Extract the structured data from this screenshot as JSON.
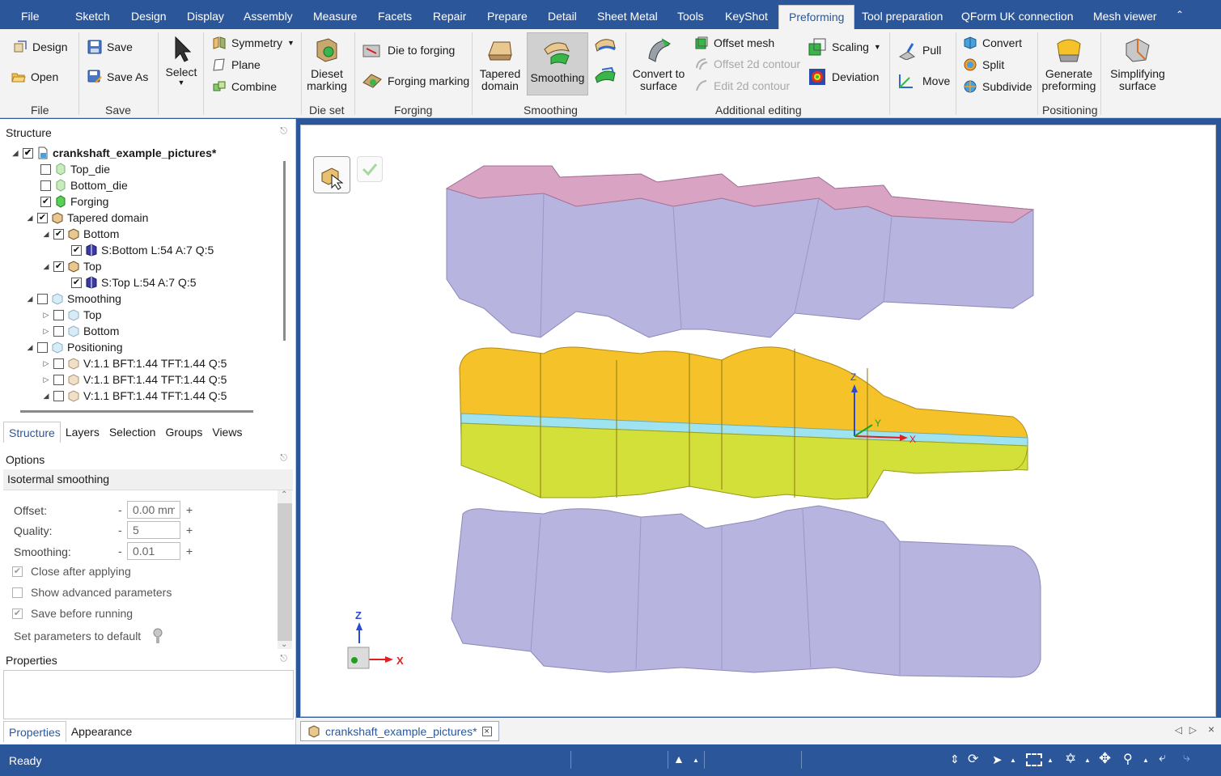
{
  "menu": {
    "items": [
      "File",
      "Sketch",
      "Design",
      "Display",
      "Assembly",
      "Measure",
      "Facets",
      "Repair",
      "Prepare",
      "Detail",
      "Sheet Metal",
      "Tools",
      "KeyShot",
      "Preforming",
      "Tool preparation",
      "QForm UK connection",
      "Mesh viewer"
    ],
    "active": "Preforming"
  },
  "ribbon": {
    "file": {
      "label": "File",
      "design": "Design",
      "open": "Open"
    },
    "save": {
      "label": "Save",
      "save": "Save",
      "save_as": "Save As"
    },
    "select": {
      "label": "Select"
    },
    "symmetry": "Symmetry",
    "plane": "Plane",
    "combine": "Combine",
    "dieset": {
      "label": "Die set",
      "btn_line1": "Dieset",
      "btn_line2": "marking"
    },
    "forging": {
      "label": "Forging",
      "die_to_forging": "Die to forging",
      "forging_marking": "Forging marking"
    },
    "smoothing": {
      "label": "Smoothing",
      "tapered_line1": "Tapered",
      "tapered_line2": "domain",
      "smoothing": "Smoothing"
    },
    "additional": {
      "label": "Additional editing",
      "convert_line1": "Convert to",
      "convert_line2": "surface",
      "offset_mesh": "Offset mesh",
      "offset_2d": "Offset 2d contour",
      "edit_2d": "Edit 2d contour",
      "scaling": "Scaling",
      "deviation": "Deviation",
      "pull": "Pull",
      "move": "Move",
      "convert": "Convert",
      "split": "Split",
      "subdivide": "Subdivide"
    },
    "positioning": {
      "label": "Positioning",
      "generate_line1": "Generate",
      "generate_line2": "preforming",
      "simplify_line1": "Simplifying",
      "simplify_line2": "surface"
    }
  },
  "structure": {
    "title": "Structure",
    "nodes": [
      {
        "label": "crankshaft_example_pictures*",
        "checked": true
      },
      {
        "label": "Top_die",
        "checked": false
      },
      {
        "label": "Bottom_die",
        "checked": false
      },
      {
        "label": "Forging",
        "checked": true
      },
      {
        "label": "Tapered domain",
        "checked": true
      },
      {
        "label": "Bottom",
        "checked": true
      },
      {
        "label": "S:Bottom L:54 A:7 Q:5",
        "checked": true
      },
      {
        "label": "Top",
        "checked": true
      },
      {
        "label": "S:Top L:54 A:7 Q:5",
        "checked": true
      },
      {
        "label": "Smoothing",
        "checked": false
      },
      {
        "label": "Top",
        "checked": false
      },
      {
        "label": "Bottom",
        "checked": false
      },
      {
        "label": "Positioning",
        "checked": false
      },
      {
        "label": "V:1.1 BFT:1.44 TFT:1.44 Q:5",
        "checked": false
      },
      {
        "label": "V:1.1 BFT:1.44 TFT:1.44 Q:5",
        "checked": false
      },
      {
        "label": "V:1.1 BFT:1.44 TFT:1.44 Q:5",
        "checked": false
      }
    ],
    "tabs": [
      "Structure",
      "Layers",
      "Selection",
      "Groups",
      "Views"
    ]
  },
  "options": {
    "title": "Options",
    "section": "Isotermal smoothing",
    "offset": {
      "label": "Offset:",
      "value": "0.00 mm"
    },
    "quality": {
      "label": "Quality:",
      "value": "5"
    },
    "smoothing": {
      "label": "Smoothing:",
      "value": "0.01"
    },
    "minus": "-",
    "plus": "+",
    "close_after": "Close after applying",
    "show_advanced": "Show advanced parameters",
    "save_before": "Save before running",
    "set_default": "Set parameters to default"
  },
  "properties": {
    "title": "Properties",
    "tabs": [
      "Properties",
      "Appearance"
    ]
  },
  "viewport": {
    "axis_z": "Z",
    "axis_x": "X",
    "axis_y": "Y",
    "tri_z": "Z",
    "tri_x": "X"
  },
  "document": {
    "tab": "crankshaft_example_pictures*"
  },
  "status": {
    "text": "Ready"
  },
  "colors": {
    "accent": "#2b579a",
    "die": "#b8b4e0",
    "die_inner": "#d9a3c4",
    "forging_top": "#f6c22a",
    "forging_bottom": "#d4e03a",
    "parting": "#9fe3f0"
  }
}
